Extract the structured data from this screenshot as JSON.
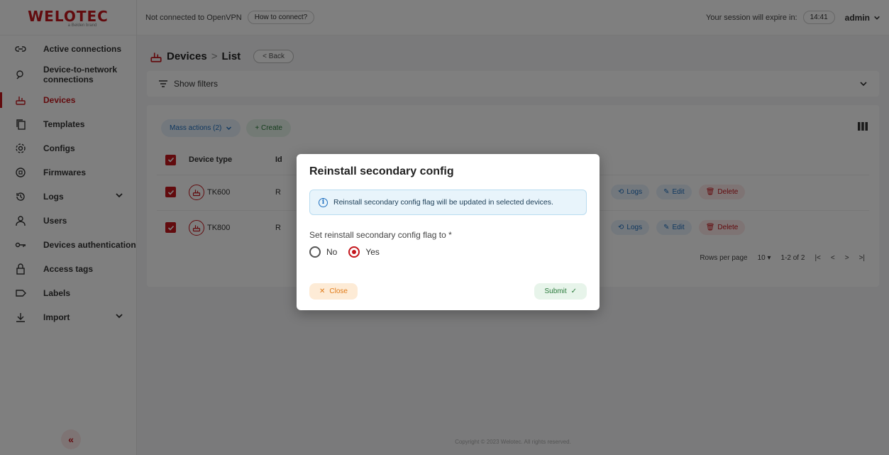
{
  "brand": {
    "logo_text": "WELOTEC",
    "logo_sub": "a Belden brand"
  },
  "topbar": {
    "vpn_status": "Not connected to OpenVPN",
    "how_to_connect": "How to connect?",
    "session_text": "Your session will expire in:",
    "session_time": "14:41",
    "user": "admin"
  },
  "sidebar": {
    "items": [
      {
        "label": "Active connections",
        "icon": "link-icon"
      },
      {
        "label": "Device-to-network connections",
        "icon": "network-icon"
      },
      {
        "label": "Devices",
        "icon": "router-icon",
        "active": true
      },
      {
        "label": "Templates",
        "icon": "copy-icon"
      },
      {
        "label": "Configs",
        "icon": "gear-icon"
      },
      {
        "label": "Firmwares",
        "icon": "chip-icon"
      },
      {
        "label": "Logs",
        "icon": "history-icon",
        "expandable": true
      },
      {
        "label": "Users",
        "icon": "user-icon"
      },
      {
        "label": "Devices authentication",
        "icon": "key-icon"
      },
      {
        "label": "Access tags",
        "icon": "lock-icon"
      },
      {
        "label": "Labels",
        "icon": "label-icon"
      },
      {
        "label": "Import",
        "icon": "download-icon",
        "expandable": true
      }
    ],
    "collapse_label": "«"
  },
  "breadcrumb": {
    "section": "Devices",
    "separator": ">",
    "current": "List",
    "back_label": "< Back"
  },
  "filters": {
    "label": "Show filters"
  },
  "toolbar": {
    "mass_actions": "Mass actions (2)",
    "create": "+ Create"
  },
  "table": {
    "headers": [
      "Device type",
      "Id"
    ],
    "rows": [
      {
        "type": "TK600",
        "id": "R"
      },
      {
        "type": "TK800",
        "id": "R"
      }
    ],
    "row_actions": {
      "logs": "Logs",
      "edit": "Edit",
      "delete": "Delete"
    },
    "pager": {
      "rows_per_page_label": "Rows per page",
      "rows_per_page": "10",
      "range": "1-2 of 2"
    }
  },
  "footer": {
    "copyright": "Copyright © 2023 Welotec. All rights reserved."
  },
  "modal": {
    "title": "Reinstall secondary config",
    "alert": "Reinstall secondary config flag will be updated in selected devices.",
    "field_label": "Set reinstall secondary config flag to *",
    "options": [
      {
        "label": "No",
        "selected": false
      },
      {
        "label": "Yes",
        "selected": true
      }
    ],
    "close_label": "Close",
    "submit_label": "Submit"
  },
  "colors": {
    "brand": "#c4161c",
    "info": "#1e6fbf",
    "success": "#2a7a3b",
    "warning": "#e07b1a"
  }
}
